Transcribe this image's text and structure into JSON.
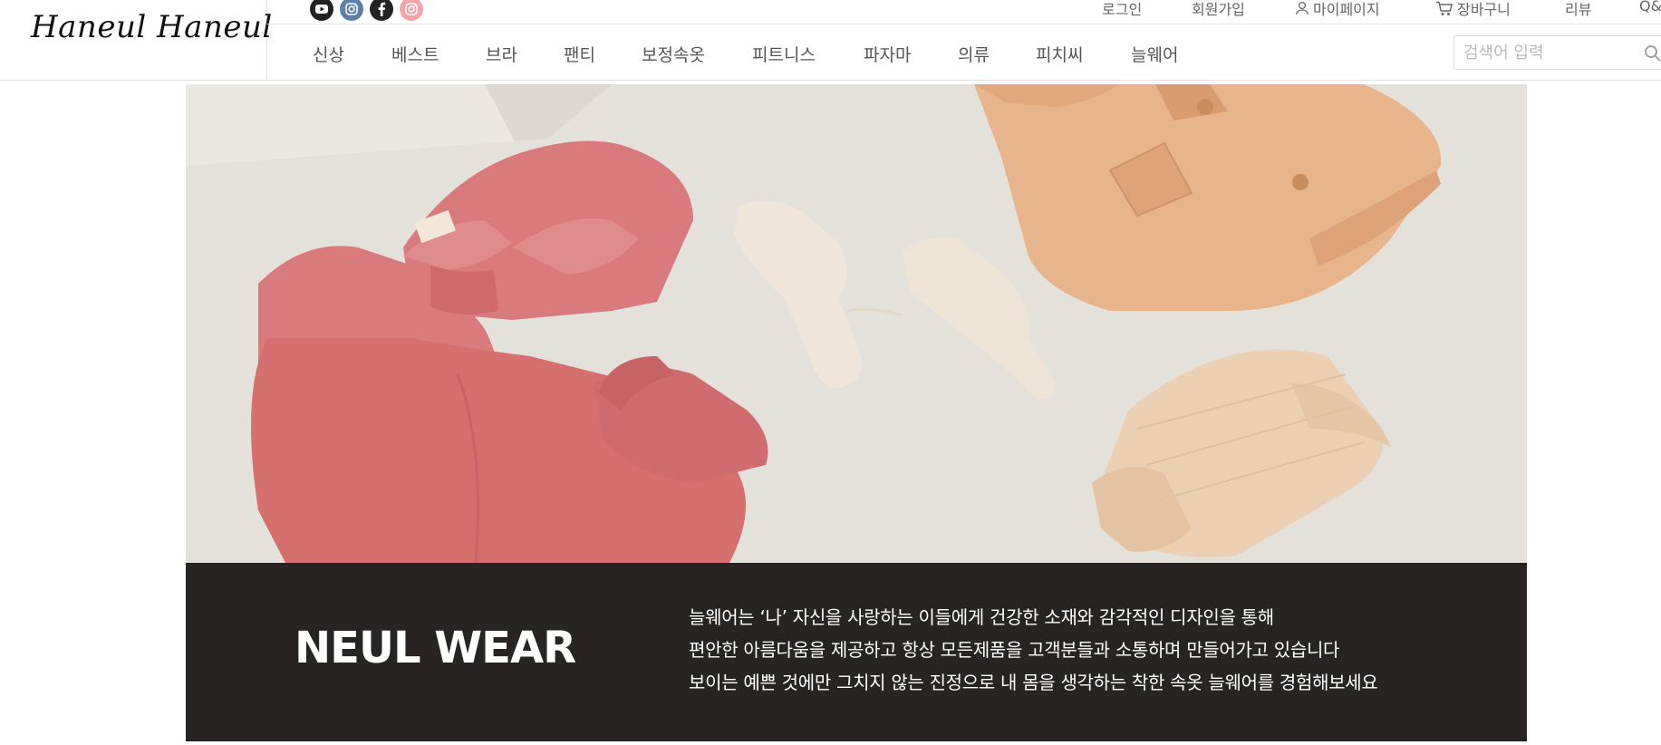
{
  "brand": {
    "logo_text": "Haneul Haneul"
  },
  "social": [
    {
      "name": "youtube-icon",
      "color": "#222222"
    },
    {
      "name": "instagram-icon",
      "color": "#5b7fa6"
    },
    {
      "name": "facebook-icon",
      "color": "#222222"
    },
    {
      "name": "instagram-pink-icon",
      "color": "#f4a3a8"
    }
  ],
  "util_menu": {
    "login": "로그인",
    "join": "회원가입",
    "mypage": "마이페이지",
    "cart": "장바구니",
    "review": "리뷰",
    "qna": "Q&A"
  },
  "nav": {
    "items": [
      "신상",
      "베스트",
      "브라",
      "팬티",
      "보정속옷",
      "피트니스",
      "파자마",
      "의류",
      "피치씨",
      "늘웨어"
    ]
  },
  "search": {
    "placeholder": "검색어 입력"
  },
  "hero": {
    "title": "NEUL WEAR",
    "lines": [
      "늘웨어는 ‘나’ 자신을 사랑하는 이들에게 건강한 소재와 감각적인 디자인을 통해",
      "편안한 아름다움을 제공하고 항상 모든제품을 고객분들과 소통하며 만들어가고 있습니다",
      "보이는 예쁜 것에만 그치지 않는 진정으로 내 몸을 생각하는 착한 속옷 늘웨어를 경험해보세요"
    ]
  },
  "colors": {
    "accent_pink": "#d9777a",
    "peach": "#eab48a",
    "cream": "#efe6d9",
    "panel": "#201e1d"
  }
}
